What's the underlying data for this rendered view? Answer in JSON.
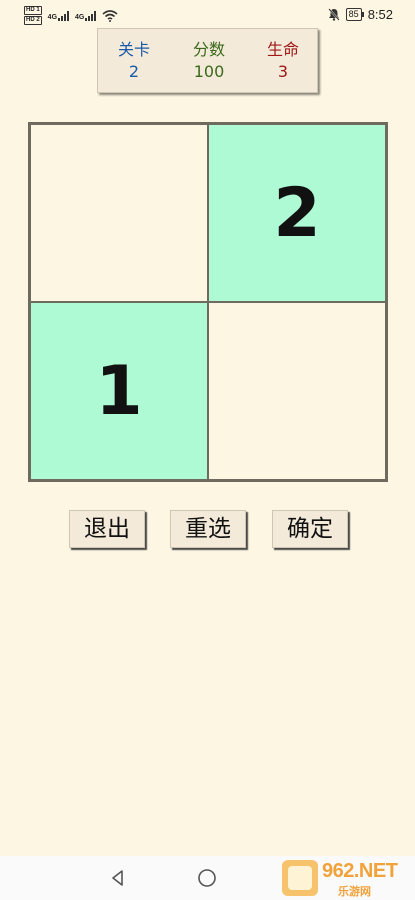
{
  "status_bar": {
    "hd1": "HD 1",
    "hd2": "HD 2",
    "net1": "4G",
    "net2": "4G",
    "battery": "85",
    "time": "8:52"
  },
  "stats": {
    "level_label": "关卡",
    "level_value": "2",
    "score_label": "分数",
    "score_value": "100",
    "life_label": "生命",
    "life_value": "3"
  },
  "board": {
    "cells": [
      {
        "value": "",
        "state": "empty"
      },
      {
        "value": "2",
        "state": "filled"
      },
      {
        "value": "1",
        "state": "filled"
      },
      {
        "value": "",
        "state": "empty"
      }
    ]
  },
  "buttons": {
    "exit": "退出",
    "reselect": "重选",
    "confirm": "确定"
  },
  "watermark": {
    "text": "962.NET",
    "sub": "乐游网"
  },
  "colors": {
    "background": "#fdf6e3",
    "filled_cell": "#adfad4",
    "level": "#1b5aa8",
    "score": "#3a6a1a",
    "life": "#a01818"
  }
}
